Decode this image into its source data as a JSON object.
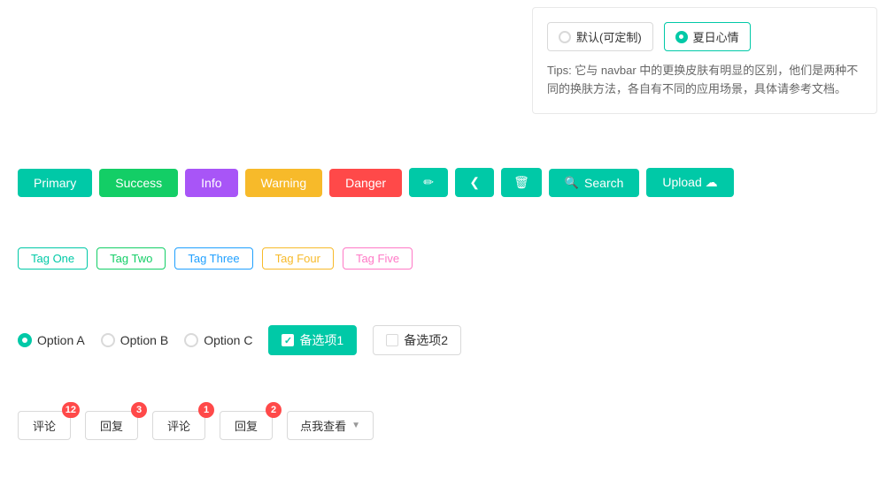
{
  "panel": {
    "theme_default_label": "默认(可定制)",
    "theme_active_label": "夏日心情",
    "tip_text": "Tips: 它与 navbar 中的更换皮肤有明显的区别，他们是两种不同的换肤方法，各自有不同的应用场景，具体请参考文档。"
  },
  "buttons": {
    "primary": "Primary",
    "success": "Success",
    "info": "Info",
    "warning": "Warning",
    "danger": "Danger",
    "edit_icon": "✏",
    "share_icon": "≪",
    "delete_icon": "🗑",
    "search_label": "Search",
    "upload_label": "Upload ☁"
  },
  "tags": {
    "one": "Tag One",
    "two": "Tag Two",
    "three": "Tag Three",
    "four": "Tag Four",
    "five": "Tag Five"
  },
  "options": {
    "option_a": "Option A",
    "option_b": "Option B",
    "option_c": "Option C",
    "checkbox1": "备选项1",
    "checkbox2": "备选项2"
  },
  "badges": {
    "comment1": "评论",
    "badge1": "12",
    "reply1": "回复",
    "badge2": "3",
    "comment2": "评论",
    "badge3": "1",
    "reply2": "回复",
    "badge4": "2",
    "dropdown": "点我查看"
  }
}
